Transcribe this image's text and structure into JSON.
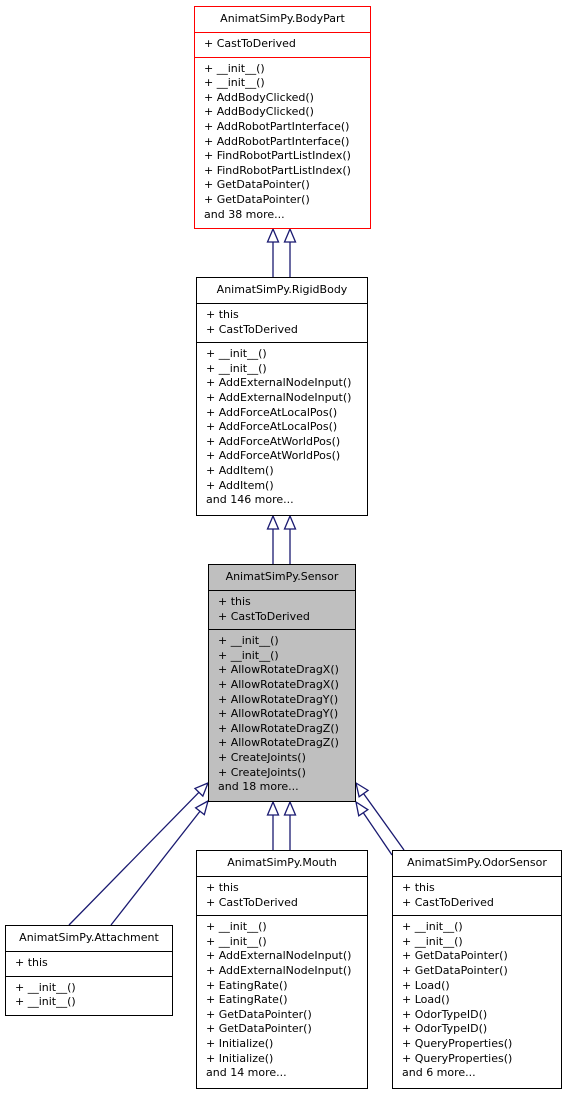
{
  "diagram": {
    "type": "inheritance-graph",
    "edge_color": "#191970",
    "root_border_color": "#ff0000",
    "current_fill_color": "#bfbfbf",
    "classes": {
      "bodypart": {
        "name": "AnimatSimPy.BodyPart",
        "attributes": [
          "+ CastToDerived"
        ],
        "methods": [
          "+ __init__()",
          "+ __init__()",
          "+ AddBodyClicked()",
          "+ AddBodyClicked()",
          "+ AddRobotPartInterface()",
          "+ AddRobotPartInterface()",
          "+ FindRobotPartListIndex()",
          "+ FindRobotPartListIndex()",
          "+ GetDataPointer()",
          "+ GetDataPointer()",
          "and 38 more..."
        ]
      },
      "rigidbody": {
        "name": "AnimatSimPy.RigidBody",
        "attributes": [
          "+ this",
          "+ CastToDerived"
        ],
        "methods": [
          "+ __init__()",
          "+ __init__()",
          "+ AddExternalNodeInput()",
          "+ AddExternalNodeInput()",
          "+ AddForceAtLocalPos()",
          "+ AddForceAtLocalPos()",
          "+ AddForceAtWorldPos()",
          "+ AddForceAtWorldPos()",
          "+ AddItem()",
          "+ AddItem()",
          "and 146 more..."
        ]
      },
      "sensor": {
        "name": "AnimatSimPy.Sensor",
        "attributes": [
          "+ this",
          "+ CastToDerived"
        ],
        "methods": [
          "+ __init__()",
          "+ __init__()",
          "+ AllowRotateDragX()",
          "+ AllowRotateDragX()",
          "+ AllowRotateDragY()",
          "+ AllowRotateDragY()",
          "+ AllowRotateDragZ()",
          "+ AllowRotateDragZ()",
          "+ CreateJoints()",
          "+ CreateJoints()",
          "and 18 more..."
        ]
      },
      "attachment": {
        "name": "AnimatSimPy.Attachment",
        "attributes": [
          "+ this"
        ],
        "methods": [
          "+ __init__()",
          "+ __init__()"
        ]
      },
      "mouth": {
        "name": "AnimatSimPy.Mouth",
        "attributes": [
          "+ this",
          "+ CastToDerived"
        ],
        "methods": [
          "+ __init__()",
          "+ __init__()",
          "+ AddExternalNodeInput()",
          "+ AddExternalNodeInput()",
          "+ EatingRate()",
          "+ EatingRate()",
          "+ GetDataPointer()",
          "+ GetDataPointer()",
          "+ Initialize()",
          "+ Initialize()",
          "and 14 more..."
        ]
      },
      "odorsensor": {
        "name": "AnimatSimPy.OdorSensor",
        "attributes": [
          "+ this",
          "+ CastToDerived"
        ],
        "methods": [
          "+ __init__()",
          "+ __init__()",
          "+ GetDataPointer()",
          "+ GetDataPointer()",
          "+ Load()",
          "+ Load()",
          "+ OdorTypeID()",
          "+ OdorTypeID()",
          "+ QueryProperties()",
          "+ QueryProperties()",
          "and 6 more..."
        ]
      }
    },
    "edges": [
      {
        "from": "rigidbody",
        "to": "bodypart"
      },
      {
        "from": "rigidbody",
        "to": "bodypart"
      },
      {
        "from": "sensor",
        "to": "rigidbody"
      },
      {
        "from": "sensor",
        "to": "rigidbody"
      },
      {
        "from": "attachment",
        "to": "sensor"
      },
      {
        "from": "attachment",
        "to": "sensor"
      },
      {
        "from": "mouth",
        "to": "sensor"
      },
      {
        "from": "mouth",
        "to": "sensor"
      },
      {
        "from": "odorsensor",
        "to": "sensor"
      },
      {
        "from": "odorsensor",
        "to": "sensor"
      }
    ]
  }
}
